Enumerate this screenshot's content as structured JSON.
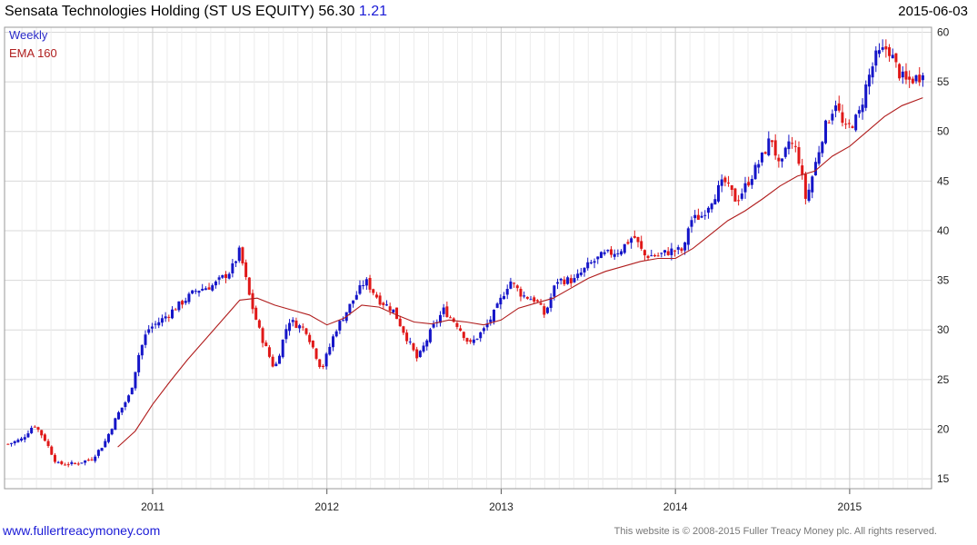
{
  "header": {
    "title": "Sensata Technologies Holding (ST US EQUITY) 56.30",
    "change": "1.21",
    "date": "2015-06-03"
  },
  "legend": {
    "weekly": "Weekly",
    "ema": "EMA 160"
  },
  "footer": {
    "site": "www.fullertreacymoney.com",
    "copyright": "This website is © 2008-2015 Fuller Treacy Money plc. All rights reserved."
  },
  "colors": {
    "up": "#1515c8",
    "down": "#e01818",
    "ema": "#b01c1c",
    "grid": "#d8d8d8",
    "frame": "#9a9a9a"
  },
  "chart_data": {
    "type": "candlestick",
    "title": "Sensata Technologies Holding (ST US EQUITY) 56.30",
    "ylim": [
      14,
      60.5
    ],
    "y_ticks": [
      15,
      20,
      25,
      30,
      35,
      40,
      45,
      50,
      55,
      60
    ],
    "x_ticks": [
      {
        "label": "2011",
        "t": 2011.0
      },
      {
        "label": "2012",
        "t": 2012.0
      },
      {
        "label": "2013",
        "t": 2013.0
      },
      {
        "label": "2014",
        "t": 2014.0
      },
      {
        "label": "2015",
        "t": 2015.0
      }
    ],
    "x_range": [
      2010.15,
      2015.47
    ],
    "grid": true,
    "legend_position": "top-left",
    "close_series": [
      {
        "t": 2010.17,
        "v": 18.5
      },
      {
        "t": 2010.25,
        "v": 19.0
      },
      {
        "t": 2010.32,
        "v": 20.5
      },
      {
        "t": 2010.38,
        "v": 19.0
      },
      {
        "t": 2010.45,
        "v": 16.5
      },
      {
        "t": 2010.55,
        "v": 16.5
      },
      {
        "t": 2010.65,
        "v": 17.0
      },
      {
        "t": 2010.72,
        "v": 18.5
      },
      {
        "t": 2010.8,
        "v": 21.5
      },
      {
        "t": 2010.87,
        "v": 23.5
      },
      {
        "t": 2010.92,
        "v": 27.5
      },
      {
        "t": 2010.97,
        "v": 30.0
      },
      {
        "t": 2011.05,
        "v": 31.0
      },
      {
        "t": 2011.15,
        "v": 32.5
      },
      {
        "t": 2011.25,
        "v": 34.0
      },
      {
        "t": 2011.35,
        "v": 34.5
      },
      {
        "t": 2011.45,
        "v": 36.0
      },
      {
        "t": 2011.5,
        "v": 38.0
      },
      {
        "t": 2011.56,
        "v": 33.0
      },
      {
        "t": 2011.62,
        "v": 29.5
      },
      {
        "t": 2011.7,
        "v": 26.0
      },
      {
        "t": 2011.78,
        "v": 31.0
      },
      {
        "t": 2011.88,
        "v": 30.0
      },
      {
        "t": 2011.97,
        "v": 26.0
      },
      {
        "t": 2012.05,
        "v": 30.0
      },
      {
        "t": 2012.15,
        "v": 33.0
      },
      {
        "t": 2012.22,
        "v": 35.0
      },
      {
        "t": 2012.3,
        "v": 33.0
      },
      {
        "t": 2012.38,
        "v": 32.0
      },
      {
        "t": 2012.45,
        "v": 29.5
      },
      {
        "t": 2012.52,
        "v": 27.0
      },
      {
        "t": 2012.6,
        "v": 30.0
      },
      {
        "t": 2012.67,
        "v": 32.0
      },
      {
        "t": 2012.75,
        "v": 30.5
      },
      {
        "t": 2012.82,
        "v": 28.5
      },
      {
        "t": 2012.9,
        "v": 30.0
      },
      {
        "t": 2012.97,
        "v": 32.0
      },
      {
        "t": 2013.05,
        "v": 35.0
      },
      {
        "t": 2013.12,
        "v": 33.5
      },
      {
        "t": 2013.2,
        "v": 33.0
      },
      {
        "t": 2013.25,
        "v": 31.5
      },
      {
        "t": 2013.32,
        "v": 35.0
      },
      {
        "t": 2013.42,
        "v": 35.0
      },
      {
        "t": 2013.5,
        "v": 36.5
      },
      {
        "t": 2013.58,
        "v": 37.5
      },
      {
        "t": 2013.68,
        "v": 38.0
      },
      {
        "t": 2013.76,
        "v": 39.5
      },
      {
        "t": 2013.82,
        "v": 37.5
      },
      {
        "t": 2013.9,
        "v": 37.5
      },
      {
        "t": 2013.98,
        "v": 38.0
      },
      {
        "t": 2014.05,
        "v": 38.0
      },
      {
        "t": 2014.08,
        "v": 41.0
      },
      {
        "t": 2014.15,
        "v": 41.5
      },
      {
        "t": 2014.22,
        "v": 43.5
      },
      {
        "t": 2014.28,
        "v": 45.0
      },
      {
        "t": 2014.35,
        "v": 43.0
      },
      {
        "t": 2014.42,
        "v": 45.0
      },
      {
        "t": 2014.5,
        "v": 47.5
      },
      {
        "t": 2014.55,
        "v": 49.5
      },
      {
        "t": 2014.6,
        "v": 46.0
      },
      {
        "t": 2014.65,
        "v": 49.0
      },
      {
        "t": 2014.7,
        "v": 48.0
      },
      {
        "t": 2014.75,
        "v": 43.0
      },
      {
        "t": 2014.8,
        "v": 46.5
      },
      {
        "t": 2014.85,
        "v": 50.0
      },
      {
        "t": 2014.92,
        "v": 53.0
      },
      {
        "t": 2014.97,
        "v": 50.0
      },
      {
        "t": 2015.05,
        "v": 51.5
      },
      {
        "t": 2015.1,
        "v": 55.0
      },
      {
        "t": 2015.15,
        "v": 57.5
      },
      {
        "t": 2015.22,
        "v": 58.5
      },
      {
        "t": 2015.28,
        "v": 56.0
      },
      {
        "t": 2015.32,
        "v": 55.0
      },
      {
        "t": 2015.4,
        "v": 55.5
      },
      {
        "t": 2015.42,
        "v": 56.3
      }
    ],
    "ema_160": [
      {
        "t": 2010.8,
        "v": 18.2
      },
      {
        "t": 2010.9,
        "v": 19.8
      },
      {
        "t": 2011.0,
        "v": 22.5
      },
      {
        "t": 2011.1,
        "v": 24.8
      },
      {
        "t": 2011.2,
        "v": 27.0
      },
      {
        "t": 2011.3,
        "v": 29.0
      },
      {
        "t": 2011.4,
        "v": 31.0
      },
      {
        "t": 2011.5,
        "v": 33.0
      },
      {
        "t": 2011.6,
        "v": 33.2
      },
      {
        "t": 2011.7,
        "v": 32.5
      },
      {
        "t": 2011.8,
        "v": 32.0
      },
      {
        "t": 2011.9,
        "v": 31.5
      },
      {
        "t": 2012.0,
        "v": 30.5
      },
      {
        "t": 2012.1,
        "v": 31.2
      },
      {
        "t": 2012.2,
        "v": 32.5
      },
      {
        "t": 2012.3,
        "v": 32.3
      },
      {
        "t": 2012.4,
        "v": 31.5
      },
      {
        "t": 2012.5,
        "v": 30.8
      },
      {
        "t": 2012.6,
        "v": 30.6
      },
      {
        "t": 2012.7,
        "v": 31.0
      },
      {
        "t": 2012.8,
        "v": 30.8
      },
      {
        "t": 2012.9,
        "v": 30.5
      },
      {
        "t": 2013.0,
        "v": 31.0
      },
      {
        "t": 2013.1,
        "v": 32.2
      },
      {
        "t": 2013.2,
        "v": 32.7
      },
      {
        "t": 2013.3,
        "v": 33.2
      },
      {
        "t": 2013.4,
        "v": 34.2
      },
      {
        "t": 2013.5,
        "v": 35.2
      },
      {
        "t": 2013.6,
        "v": 35.9
      },
      {
        "t": 2013.7,
        "v": 36.4
      },
      {
        "t": 2013.8,
        "v": 36.9
      },
      {
        "t": 2013.9,
        "v": 37.2
      },
      {
        "t": 2014.0,
        "v": 37.2
      },
      {
        "t": 2014.1,
        "v": 38.2
      },
      {
        "t": 2014.2,
        "v": 39.6
      },
      {
        "t": 2014.3,
        "v": 41.0
      },
      {
        "t": 2014.4,
        "v": 42.0
      },
      {
        "t": 2014.5,
        "v": 43.2
      },
      {
        "t": 2014.6,
        "v": 44.5
      },
      {
        "t": 2014.7,
        "v": 45.5
      },
      {
        "t": 2014.8,
        "v": 46.0
      },
      {
        "t": 2014.9,
        "v": 47.5
      },
      {
        "t": 2015.0,
        "v": 48.5
      },
      {
        "t": 2015.1,
        "v": 50.0
      },
      {
        "t": 2015.2,
        "v": 51.5
      },
      {
        "t": 2015.3,
        "v": 52.6
      },
      {
        "t": 2015.42,
        "v": 53.4
      }
    ]
  }
}
